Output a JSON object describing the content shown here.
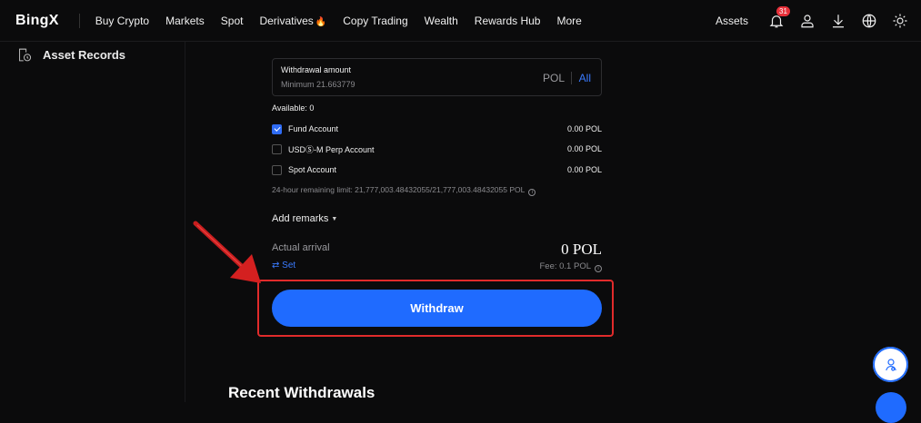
{
  "header": {
    "logo": "BingX",
    "nav": [
      "Buy Crypto",
      "Markets",
      "Spot",
      "Derivatives",
      "Copy Trading",
      "Wealth",
      "Rewards Hub",
      "More"
    ],
    "derivatives_badge": "🔥",
    "assets_label": "Assets",
    "notification_count": "31",
    "icons": [
      "bell-icon",
      "user-icon",
      "download-icon",
      "globe-icon",
      "sun-icon"
    ]
  },
  "sidebar": {
    "items": [
      {
        "label": "Asset Records",
        "icon": "clock-document-icon"
      }
    ]
  },
  "withdraw_form": {
    "amount_label": "Withdrawal amount",
    "amount_placeholder": "Minimum 21.663779",
    "amount_unit": "POL",
    "all_label": "All",
    "available": "Available:  0",
    "accounts": [
      {
        "name": "Fund Account",
        "value": "0.00 POL",
        "checked": true
      },
      {
        "name": "USDⓈ-M Perp Account",
        "value": "0.00 POL",
        "checked": false
      },
      {
        "name": "Spot Account",
        "value": "0.00 POL",
        "checked": false
      }
    ],
    "limit_text": "24-hour remaining limit:  21,777,003.48432055/21,777,003.48432055 POL",
    "add_remarks": "Add remarks",
    "actual_arrival_label": "Actual arrival",
    "actual_arrival_value": "0 POL",
    "set_label": "⇄ Set",
    "fee_text": "Fee:  0.1 POL",
    "withdraw_button": "Withdraw"
  },
  "recent": {
    "title": "Recent Withdrawals"
  },
  "colors": {
    "accent": "#1f6bff",
    "highlight": "#e12b2b",
    "background": "#0b0b0c"
  }
}
